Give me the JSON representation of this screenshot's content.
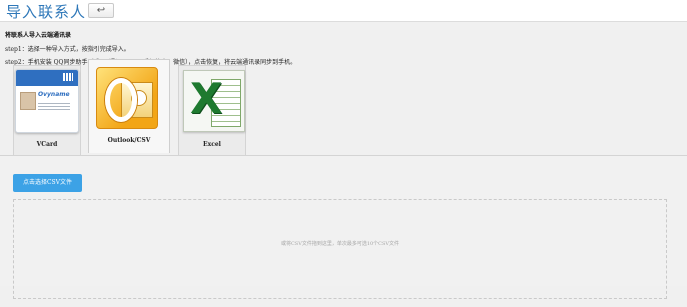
{
  "header": {
    "title": "导入联系人",
    "back_button": "↩"
  },
  "panel": {
    "section_title": "将联系人导入云端通讯录",
    "step1": "step1：选择一种导入方式，按指引完成导入。",
    "step2": "step2：手机安装 QQ同步助手（或QQ通讯录、QQ手机管家、微信），点击恢复，将云端通讯录同步到手机。"
  },
  "tabs": [
    {
      "label": "VCard",
      "icon": "vcard-icon",
      "active": false
    },
    {
      "label": "Outlook/CSV",
      "icon": "outlook-icon",
      "active": true
    },
    {
      "label": "Excel",
      "icon": "excel-icon",
      "active": false
    }
  ],
  "vcard_icon_text": "Ovyname",
  "content": {
    "upload_button": "点击选择CSV文件",
    "drop_hint": "或将CSV文件拖到这里，单次最多可选10个CSV文件"
  },
  "colors": {
    "title": "#2f78b9",
    "button": "#3ca2e6"
  }
}
